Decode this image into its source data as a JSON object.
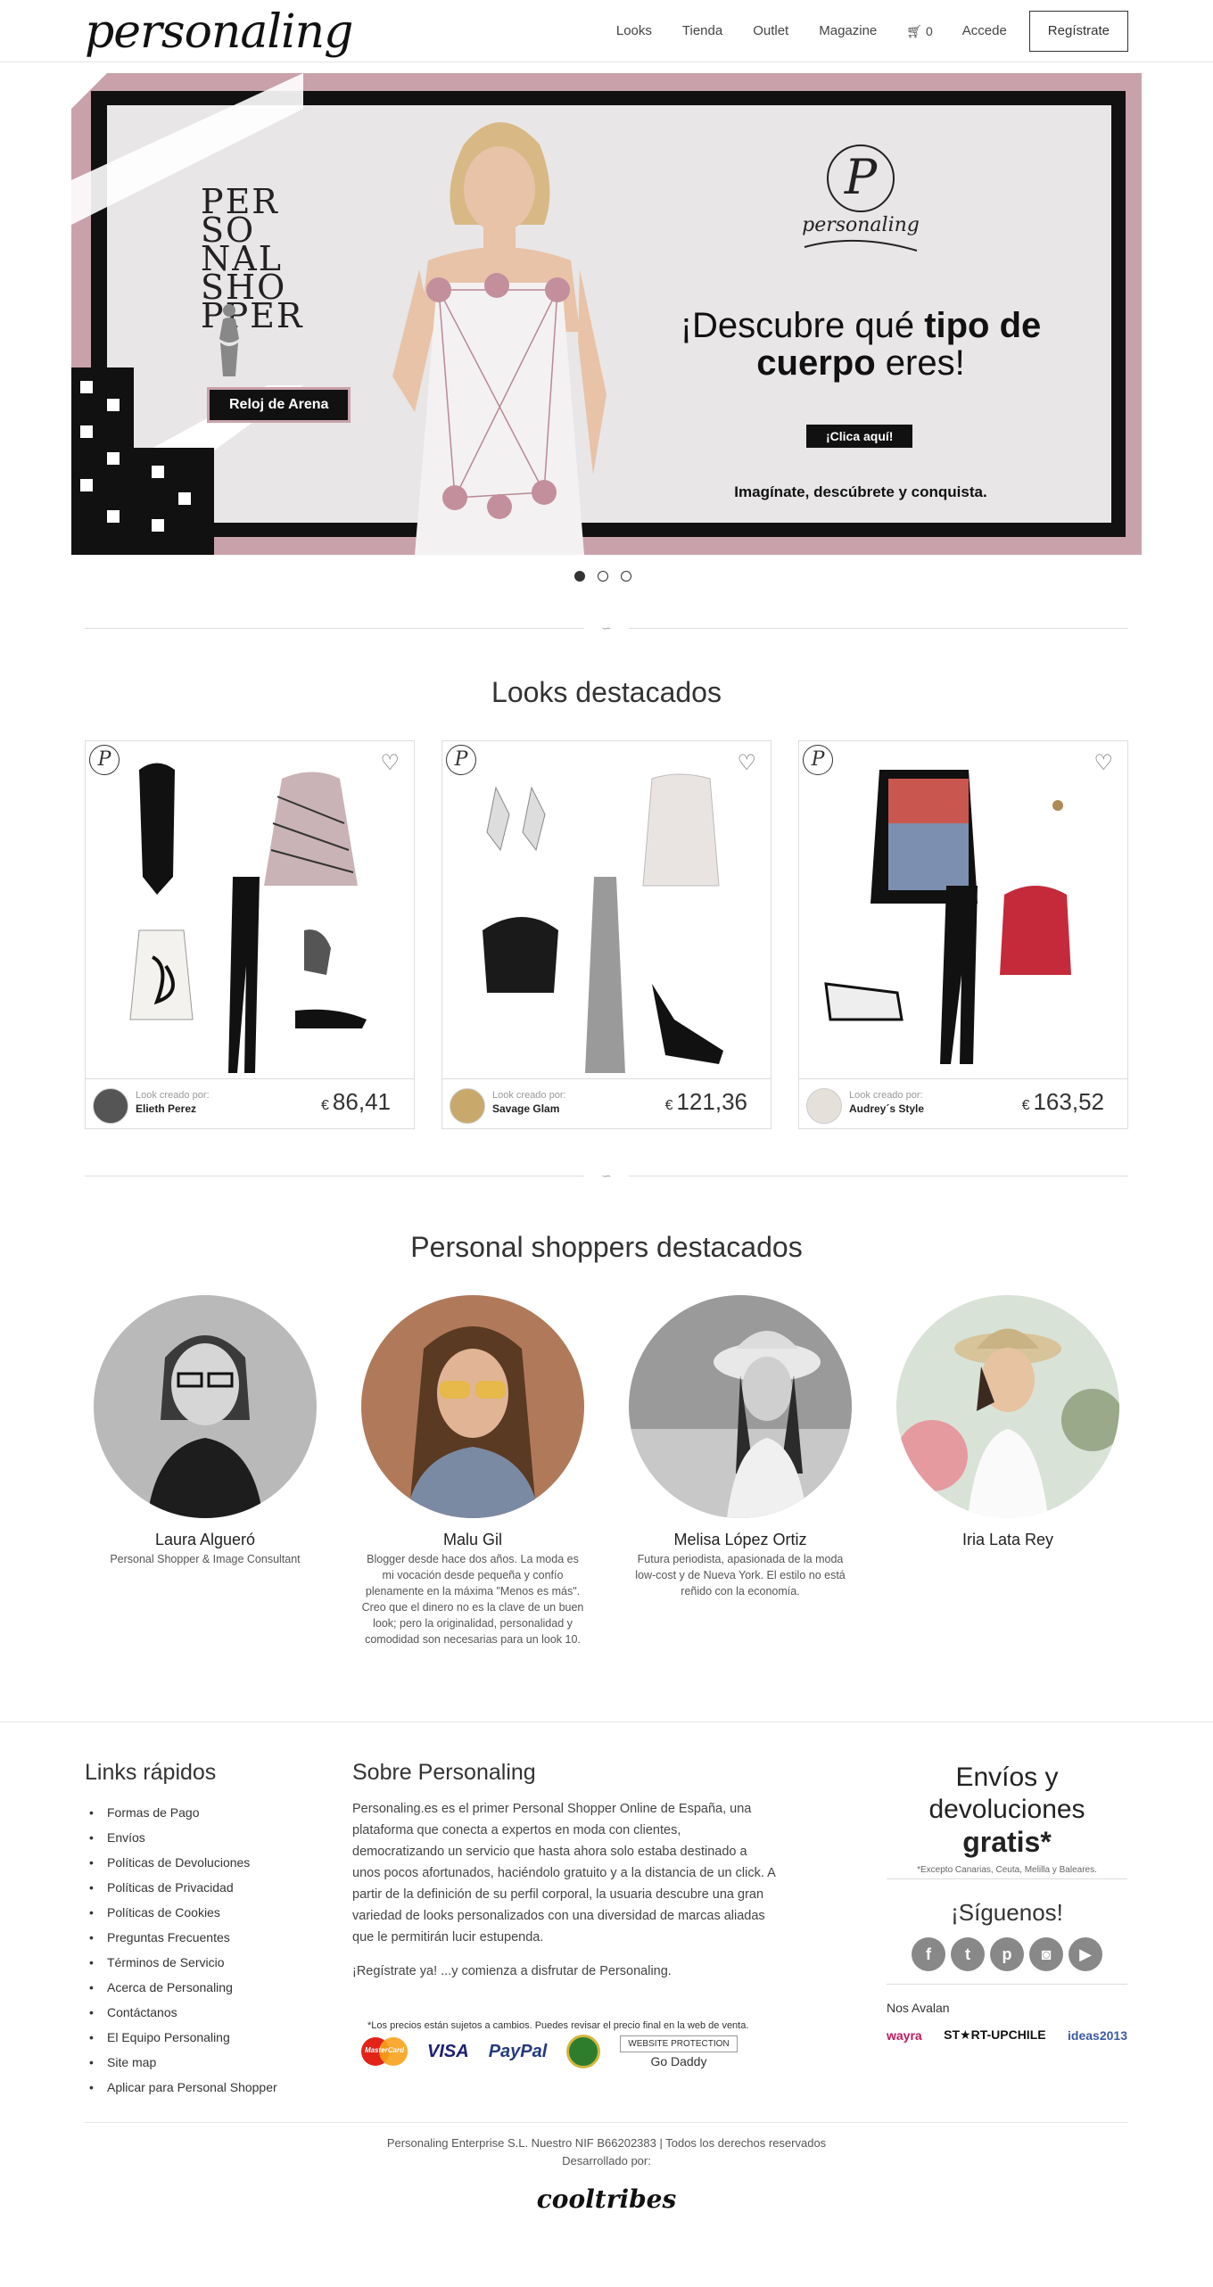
{
  "nav": {
    "logo": "personaling",
    "links": [
      "Looks",
      "Tienda",
      "Outlet",
      "Magazine"
    ],
    "cart_count": "0",
    "login": "Accede",
    "register": "Regístrate"
  },
  "hero": {
    "side_word": "PER SO NAL SHO PPER",
    "body_tag": "Reloj de Arena",
    "brand_name": "personaling",
    "title_pre": "¡Descubre qué ",
    "title_bold1": "tipo de",
    "title_bold2": "cuerpo",
    "title_post": " eres!",
    "cta": "¡Clica aquí!",
    "tagline": "Imagínate, descúbrete y conquista.",
    "accent": "#c9a1aa"
  },
  "looks_section": {
    "title": "Looks destacados",
    "created_by_label": "Look creado por:",
    "currency": "€",
    "cards": [
      {
        "author": "Elieth Perez",
        "price": "86,41"
      },
      {
        "author": "Savage Glam",
        "price": "121,36"
      },
      {
        "author": "Audrey´s Style",
        "price": "163,52"
      }
    ]
  },
  "shoppers_section": {
    "title": "Personal shoppers destacados",
    "shoppers": [
      {
        "name": "Laura Algueró",
        "desc": "Personal Shopper & Image Consultant"
      },
      {
        "name": "Malu Gil",
        "desc": "Blogger desde hace dos años. La moda es mi vocación desde pequeña y confío plenamente en la máxima \"Menos es más\". Creo que el dinero no es la clave de un buen look; pero la originalidad, personalidad y comodidad son necesarias para un look 10."
      },
      {
        "name": "Melisa López Ortiz",
        "desc": "Futura periodista, apasionada de la moda low-cost y de Nueva York. El estilo no está reñido con la economía."
      },
      {
        "name": "Iria Lata Rey",
        "desc": ""
      }
    ]
  },
  "footer": {
    "quick_title": "Links rápidos",
    "quick_links": [
      "Formas de Pago",
      "Envíos",
      "Políticas de Devoluciones",
      "Políticas de Privacidad",
      "Políticas de Cookies",
      "Preguntas Frecuentes",
      "Términos de Servicio",
      "Acerca de Personaling",
      "Contáctanos",
      "El Equipo Personaling",
      "Site map",
      "Aplicar para Personal Shopper"
    ],
    "about_title": "Sobre Personaling",
    "about_text": "Personaling.es es el primer Personal Shopper Online de España, una plataforma que conecta a expertos en moda con clientes, democratizando un servicio que hasta ahora solo estaba destinado a unos pocos afortunados, haciéndolo gratuito y a la distancia de un click. A partir de la definición de su perfil corporal, la usuaria descubre una gran variedad de looks personalizados con una diversidad de marcas aliadas que le permitirán lucir estupenda.",
    "about_cta": "¡Regístrate ya! ...y comienza a disfrutar de Personaling.",
    "price_note": "*Los precios están sujetos a cambios. Puedes revisar el precio final en la web de venta.",
    "pay": [
      "MasterCard",
      "VISA",
      "PayPal"
    ],
    "godaddy_top": "WEBSITE PROTECTION",
    "godaddy": "Go Daddy",
    "envios_l1": "Envíos y",
    "envios_l2": "devoluciones",
    "envios_bold": "gratis*",
    "envios_note": "*Excepto Canarias, Ceuta, Melilla y Baleares.",
    "follow": "¡Síguenos!",
    "social": [
      "f",
      "t",
      "p",
      "◙",
      "▶"
    ],
    "avalan": "Nos Avalan",
    "partners": [
      "wayra",
      "ST★RT-UPCHILE",
      "ideas2013"
    ],
    "copyright": "Personaling Enterprise S.L. Nuestro NIF B66202383 | Todos los derechos reservados",
    "dev_by": "Desarrollado por:",
    "dev": "cooltribes"
  }
}
